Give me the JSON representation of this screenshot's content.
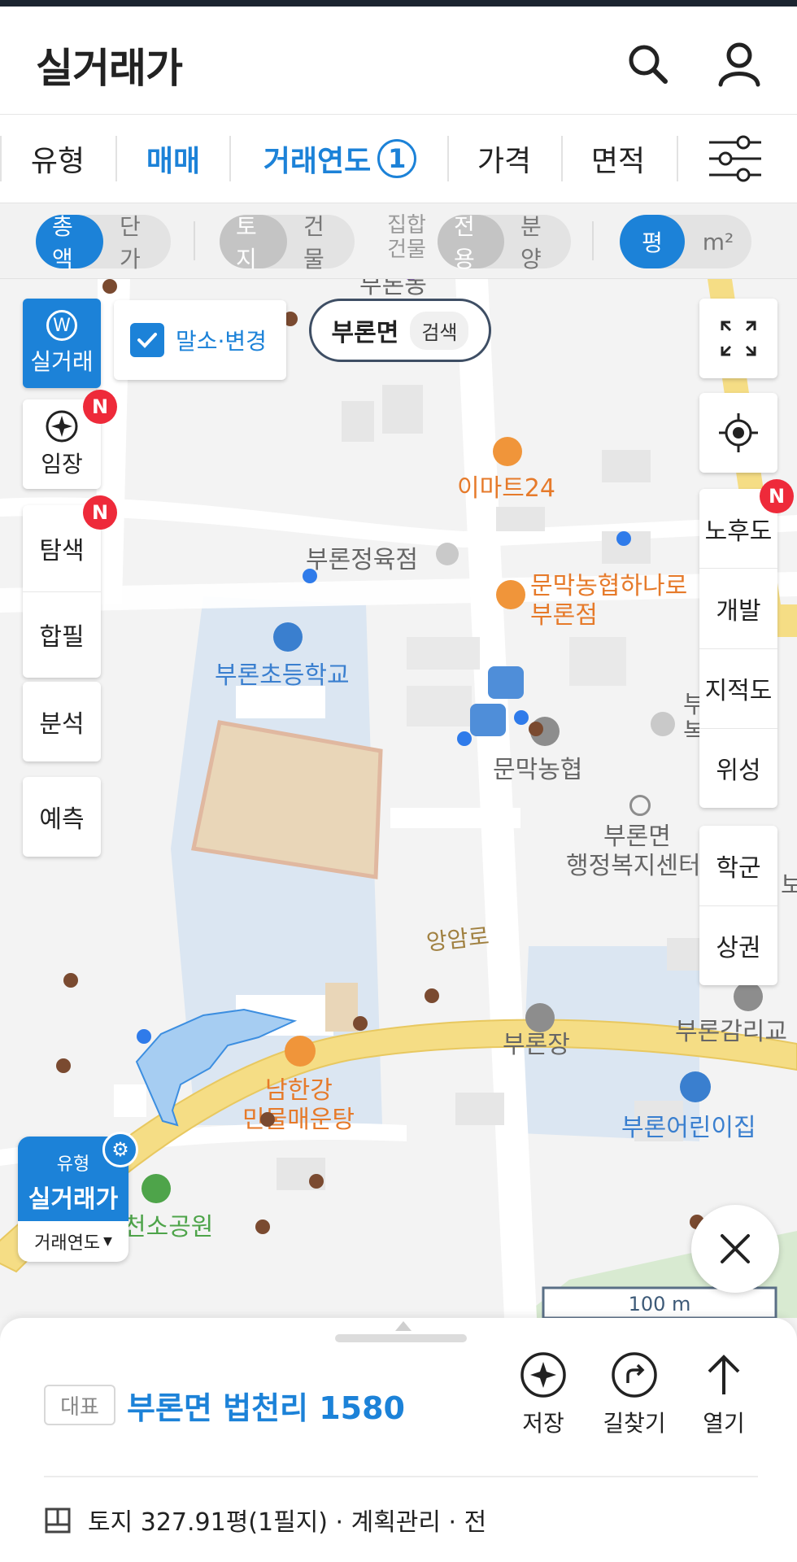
{
  "header": {
    "title": "실거래가"
  },
  "tabs": {
    "type": "유형",
    "deal": "매매",
    "year": "거래연도",
    "year_count": "1",
    "price": "가격",
    "area": "면적"
  },
  "toggles": {
    "total": "총액",
    "unit": "단가",
    "land": "토지",
    "building": "건물",
    "group_line1": "집합",
    "group_line2": "건물",
    "exclusive": "전용",
    "sale": "분양",
    "pyeong": "평",
    "sqm": "m²"
  },
  "map": {
    "search_region": "부론면",
    "search_button": "검색",
    "cancel_toggle": "말소·변경",
    "labels": {
      "emart": "이마트24",
      "butcher": "부론정육점",
      "nonghyup_mart_1": "문막농협하나로",
      "nonghyup_mart_2": "부론점",
      "school": "부론초등학교",
      "nonghyup": "문막농협",
      "office_1": "부론면",
      "office_2": "행정복지센터",
      "road": "앙암로",
      "inn": "부론장",
      "church": "부론감리교",
      "restaurant_1": "남한강",
      "restaurant_2": "민물매운탕",
      "kindergarten": "부론어린이집",
      "park": "천소공원",
      "partial_1": "부",
      "partial_2": "복",
      "partial_3": "보",
      "partial_top": "부론동"
    },
    "scale": "100 m"
  },
  "left_buttons": {
    "realprice": "실거래",
    "auction": "임장",
    "explore": "탐색",
    "merge": "합필",
    "analysis": "분석",
    "predict": "예측",
    "new_badge": "N"
  },
  "right_buttons": {
    "aging": "노후도",
    "development": "개발",
    "cadastral": "지적도",
    "satellite": "위성",
    "school_district": "학군",
    "commercial": "상권",
    "new_badge": "N"
  },
  "type_card": {
    "label": "유형",
    "value": "실거래가",
    "filter": "거래연도"
  },
  "sheet": {
    "tag": "대표",
    "address": "부론면 법천리 1580",
    "save": "저장",
    "directions": "길찾기",
    "open": "열기",
    "detail": "토지 327.91평(1필지) · 계획관리 · 전"
  },
  "colors": {
    "accent": "#1c82d8",
    "badge": "#ee2a3a",
    "road": "#f5dd85",
    "school_area": "#dbe6f2",
    "poi_orange": "#f0953a",
    "poi_blue": "#3a7fcf"
  }
}
